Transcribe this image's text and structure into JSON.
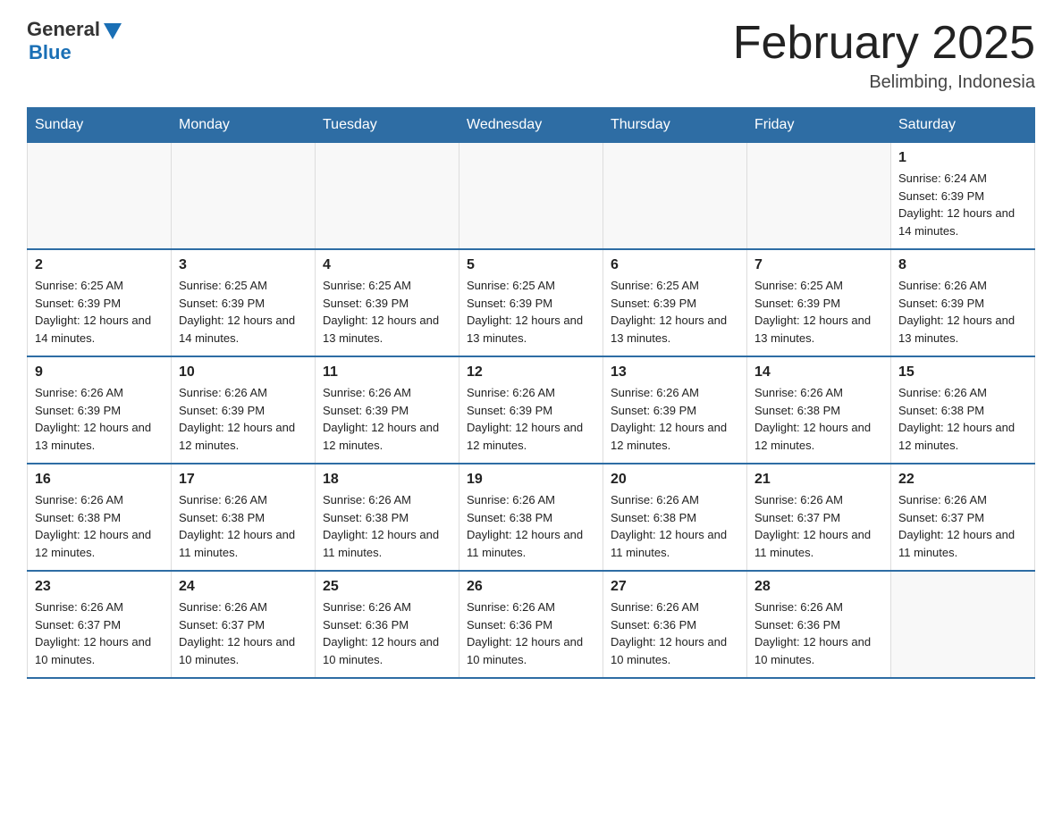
{
  "logo": {
    "general": "General",
    "blue": "Blue"
  },
  "title": "February 2025",
  "location": "Belimbing, Indonesia",
  "days_of_week": [
    "Sunday",
    "Monday",
    "Tuesday",
    "Wednesday",
    "Thursday",
    "Friday",
    "Saturday"
  ],
  "weeks": [
    [
      {
        "day": "",
        "info": ""
      },
      {
        "day": "",
        "info": ""
      },
      {
        "day": "",
        "info": ""
      },
      {
        "day": "",
        "info": ""
      },
      {
        "day": "",
        "info": ""
      },
      {
        "day": "",
        "info": ""
      },
      {
        "day": "1",
        "info": "Sunrise: 6:24 AM\nSunset: 6:39 PM\nDaylight: 12 hours and 14 minutes."
      }
    ],
    [
      {
        "day": "2",
        "info": "Sunrise: 6:25 AM\nSunset: 6:39 PM\nDaylight: 12 hours and 14 minutes."
      },
      {
        "day": "3",
        "info": "Sunrise: 6:25 AM\nSunset: 6:39 PM\nDaylight: 12 hours and 14 minutes."
      },
      {
        "day": "4",
        "info": "Sunrise: 6:25 AM\nSunset: 6:39 PM\nDaylight: 12 hours and 13 minutes."
      },
      {
        "day": "5",
        "info": "Sunrise: 6:25 AM\nSunset: 6:39 PM\nDaylight: 12 hours and 13 minutes."
      },
      {
        "day": "6",
        "info": "Sunrise: 6:25 AM\nSunset: 6:39 PM\nDaylight: 12 hours and 13 minutes."
      },
      {
        "day": "7",
        "info": "Sunrise: 6:25 AM\nSunset: 6:39 PM\nDaylight: 12 hours and 13 minutes."
      },
      {
        "day": "8",
        "info": "Sunrise: 6:26 AM\nSunset: 6:39 PM\nDaylight: 12 hours and 13 minutes."
      }
    ],
    [
      {
        "day": "9",
        "info": "Sunrise: 6:26 AM\nSunset: 6:39 PM\nDaylight: 12 hours and 13 minutes."
      },
      {
        "day": "10",
        "info": "Sunrise: 6:26 AM\nSunset: 6:39 PM\nDaylight: 12 hours and 12 minutes."
      },
      {
        "day": "11",
        "info": "Sunrise: 6:26 AM\nSunset: 6:39 PM\nDaylight: 12 hours and 12 minutes."
      },
      {
        "day": "12",
        "info": "Sunrise: 6:26 AM\nSunset: 6:39 PM\nDaylight: 12 hours and 12 minutes."
      },
      {
        "day": "13",
        "info": "Sunrise: 6:26 AM\nSunset: 6:39 PM\nDaylight: 12 hours and 12 minutes."
      },
      {
        "day": "14",
        "info": "Sunrise: 6:26 AM\nSunset: 6:38 PM\nDaylight: 12 hours and 12 minutes."
      },
      {
        "day": "15",
        "info": "Sunrise: 6:26 AM\nSunset: 6:38 PM\nDaylight: 12 hours and 12 minutes."
      }
    ],
    [
      {
        "day": "16",
        "info": "Sunrise: 6:26 AM\nSunset: 6:38 PM\nDaylight: 12 hours and 12 minutes."
      },
      {
        "day": "17",
        "info": "Sunrise: 6:26 AM\nSunset: 6:38 PM\nDaylight: 12 hours and 11 minutes."
      },
      {
        "day": "18",
        "info": "Sunrise: 6:26 AM\nSunset: 6:38 PM\nDaylight: 12 hours and 11 minutes."
      },
      {
        "day": "19",
        "info": "Sunrise: 6:26 AM\nSunset: 6:38 PM\nDaylight: 12 hours and 11 minutes."
      },
      {
        "day": "20",
        "info": "Sunrise: 6:26 AM\nSunset: 6:38 PM\nDaylight: 12 hours and 11 minutes."
      },
      {
        "day": "21",
        "info": "Sunrise: 6:26 AM\nSunset: 6:37 PM\nDaylight: 12 hours and 11 minutes."
      },
      {
        "day": "22",
        "info": "Sunrise: 6:26 AM\nSunset: 6:37 PM\nDaylight: 12 hours and 11 minutes."
      }
    ],
    [
      {
        "day": "23",
        "info": "Sunrise: 6:26 AM\nSunset: 6:37 PM\nDaylight: 12 hours and 10 minutes."
      },
      {
        "day": "24",
        "info": "Sunrise: 6:26 AM\nSunset: 6:37 PM\nDaylight: 12 hours and 10 minutes."
      },
      {
        "day": "25",
        "info": "Sunrise: 6:26 AM\nSunset: 6:36 PM\nDaylight: 12 hours and 10 minutes."
      },
      {
        "day": "26",
        "info": "Sunrise: 6:26 AM\nSunset: 6:36 PM\nDaylight: 12 hours and 10 minutes."
      },
      {
        "day": "27",
        "info": "Sunrise: 6:26 AM\nSunset: 6:36 PM\nDaylight: 12 hours and 10 minutes."
      },
      {
        "day": "28",
        "info": "Sunrise: 6:26 AM\nSunset: 6:36 PM\nDaylight: 12 hours and 10 minutes."
      },
      {
        "day": "",
        "info": ""
      }
    ]
  ]
}
